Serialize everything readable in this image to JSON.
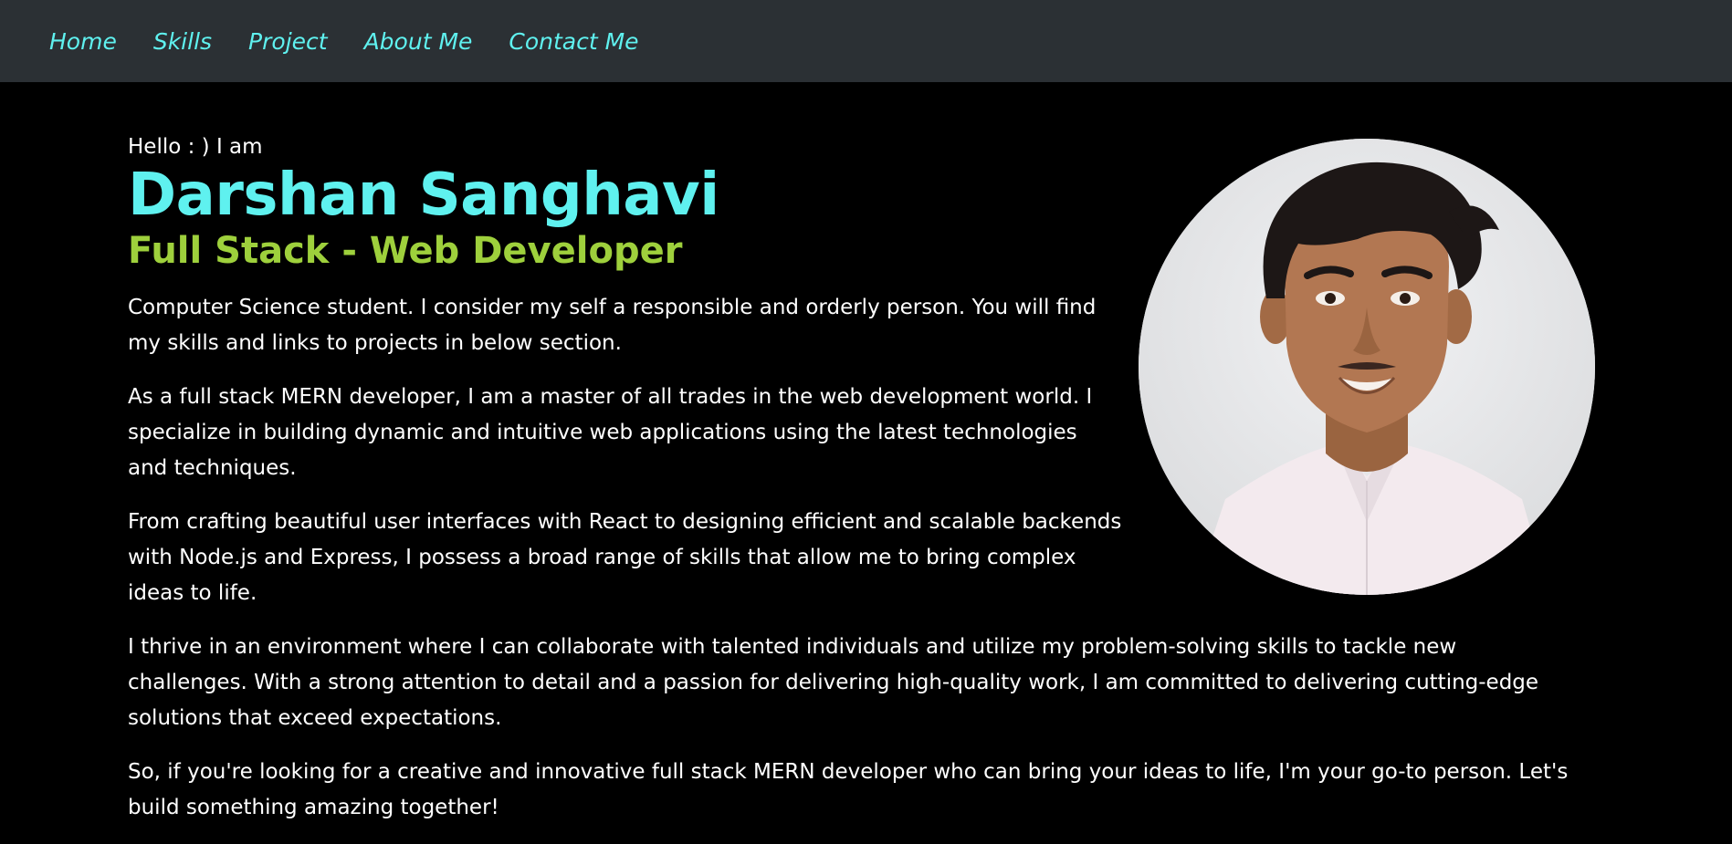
{
  "nav": {
    "items": [
      {
        "label": "Home"
      },
      {
        "label": "Skills"
      },
      {
        "label": "Project"
      },
      {
        "label": "About Me"
      },
      {
        "label": "Contact Me"
      }
    ]
  },
  "hero": {
    "greeting": "Hello : ) I am",
    "name": "Darshan Sanghavi",
    "role": "Full Stack - Web Developer",
    "paragraphs": [
      "Computer Science student. I consider my self a responsible and orderly person. You will find my skills and links to projects in below section.",
      "As a full stack MERN developer, I am a master of all trades in the web development world. I specialize in building dynamic and intuitive web applications using the latest technologies and techniques.",
      "From crafting beautiful user interfaces with React to designing efficient and scalable backends with Node.js and Express, I possess a broad range of skills that allow me to bring complex ideas to life.",
      "I thrive in an environment where I can collaborate with talented individuals and utilize my problem-solving skills to tackle new challenges. With a strong attention to detail and a passion for delivering high-quality work, I am committed to delivering cutting-edge solutions that exceed expectations.",
      "So, if you're looking for a creative and innovative full stack MERN developer who can bring your ideas to life, I'm your go-to person. Let's build something amazing together!"
    ]
  },
  "colors": {
    "nav_bg": "#2b3034",
    "accent_cyan": "#5ff1ef",
    "accent_green": "#9ed03c",
    "page_bg": "#000000"
  }
}
